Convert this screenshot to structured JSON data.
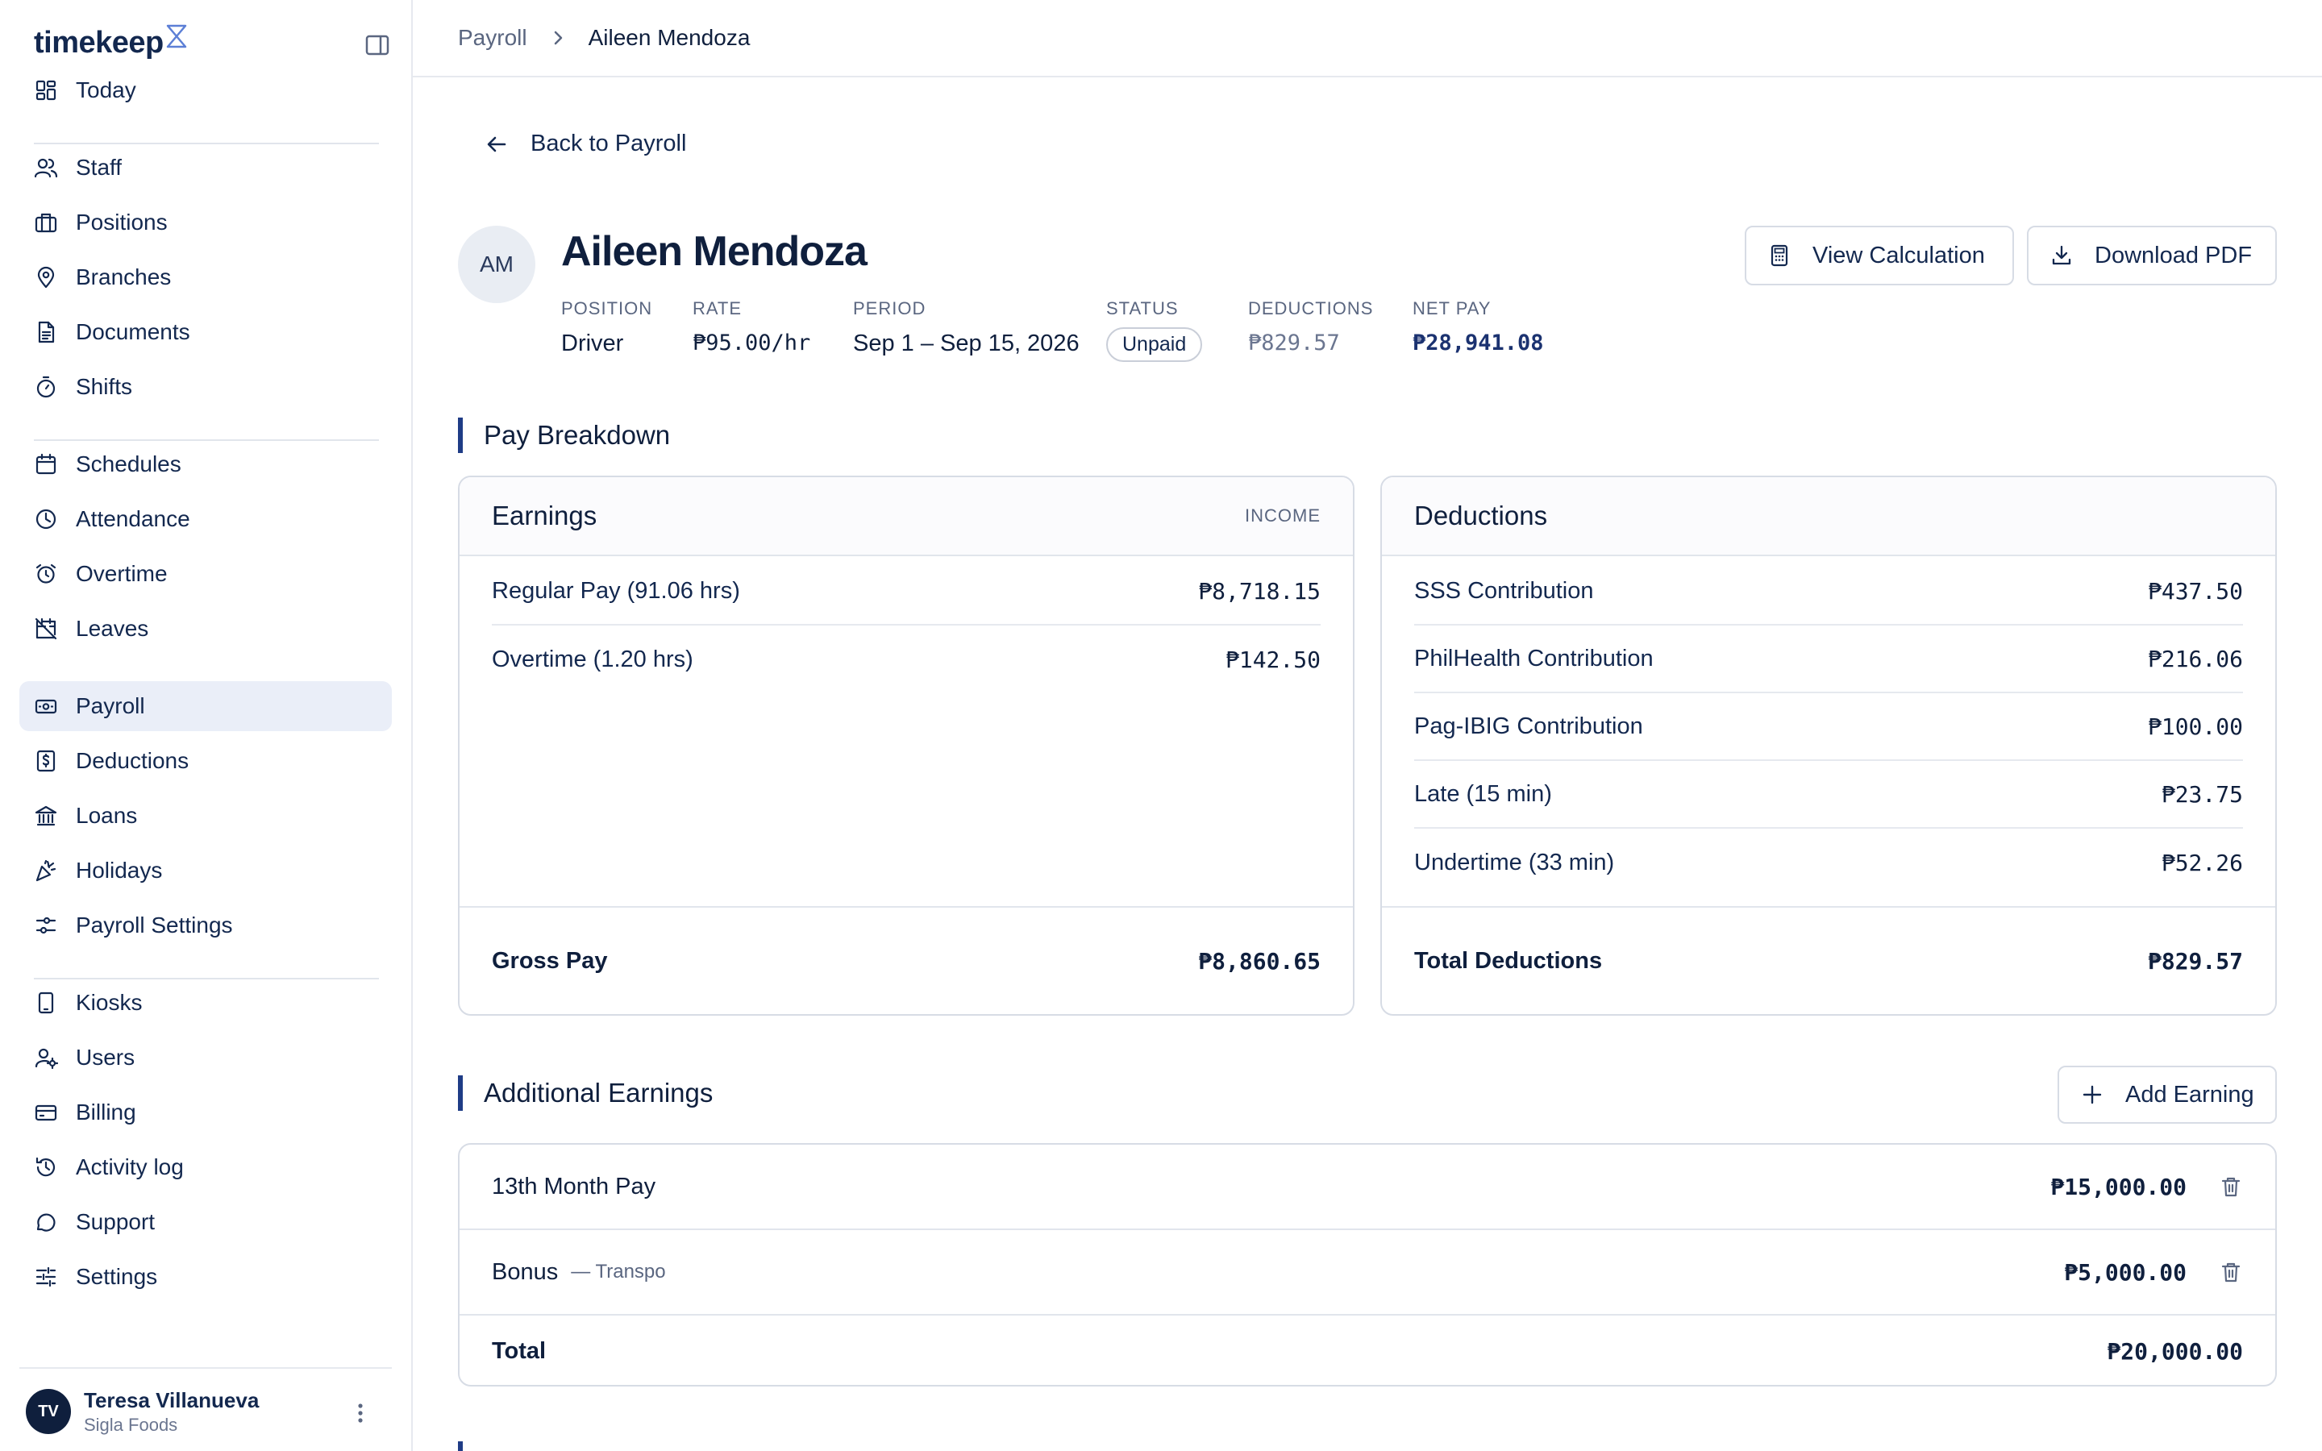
{
  "brand": {
    "name": "timekeep"
  },
  "sidebar": {
    "groups": [
      [
        {
          "label": "Today",
          "icon": "dashboard-icon"
        }
      ],
      [
        {
          "label": "Staff",
          "icon": "users-icon"
        },
        {
          "label": "Positions",
          "icon": "briefcase-icon"
        },
        {
          "label": "Branches",
          "icon": "map-pin-icon"
        },
        {
          "label": "Documents",
          "icon": "document-icon"
        },
        {
          "label": "Shifts",
          "icon": "timer-icon"
        }
      ],
      [
        {
          "label": "Schedules",
          "icon": "calendar-icon"
        },
        {
          "label": "Attendance",
          "icon": "clock-icon"
        },
        {
          "label": "Overtime",
          "icon": "alarm-icon"
        },
        {
          "label": "Leaves",
          "icon": "calendar-off-icon"
        }
      ],
      [
        {
          "label": "Payroll",
          "icon": "banknote-icon",
          "active": true
        },
        {
          "label": "Deductions",
          "icon": "receipt-dollar-icon"
        },
        {
          "label": "Loans",
          "icon": "bank-icon"
        },
        {
          "label": "Holidays",
          "icon": "party-icon"
        },
        {
          "label": "Payroll Settings",
          "icon": "sliders-icon"
        }
      ],
      [
        {
          "label": "Kiosks",
          "icon": "tablet-icon"
        },
        {
          "label": "Users",
          "icon": "user-cog-icon"
        },
        {
          "label": "Billing",
          "icon": "credit-card-icon"
        },
        {
          "label": "Activity log",
          "icon": "history-icon"
        },
        {
          "label": "Support",
          "icon": "chat-icon"
        },
        {
          "label": "Settings",
          "icon": "settings-sliders-icon"
        }
      ]
    ],
    "user": {
      "initials": "TV",
      "name": "Teresa Villanueva",
      "org": "Sigla Foods"
    }
  },
  "breadcrumb": {
    "parent": "Payroll",
    "current": "Aileen Mendoza"
  },
  "back_label": "Back to Payroll",
  "employee": {
    "initials": "AM",
    "name": "Aileen Mendoza",
    "meta": {
      "position_label": "POSITION",
      "position": "Driver",
      "rate_label": "RATE",
      "rate": "₱95.00/hr",
      "period_label": "PERIOD",
      "period": "Sep 1 – Sep 15, 2026",
      "status_label": "STATUS",
      "status": "Unpaid",
      "deductions_label": "DEDUCTIONS",
      "deductions": "₱829.57",
      "netpay_label": "NET PAY",
      "netpay": "₱28,941.08"
    }
  },
  "actions": {
    "view_calculation": "View Calculation",
    "download_pdf": "Download PDF"
  },
  "pay_breakdown": {
    "title": "Pay Breakdown",
    "earnings": {
      "title": "Earnings",
      "tag": "INCOME",
      "rows": [
        {
          "label": "Regular Pay (91.06 hrs)",
          "amount": "₱8,718.15"
        },
        {
          "label": "Overtime (1.20 hrs)",
          "amount": "₱142.50"
        }
      ],
      "total_label": "Gross Pay",
      "total": "₱8,860.65"
    },
    "deductions": {
      "title": "Deductions",
      "rows": [
        {
          "label": "SSS Contribution",
          "amount": "₱437.50"
        },
        {
          "label": "PhilHealth Contribution",
          "amount": "₱216.06"
        },
        {
          "label": "Pag-IBIG Contribution",
          "amount": "₱100.00"
        },
        {
          "label": "Late (15 min)",
          "amount": "₱23.75"
        },
        {
          "label": "Undertime (33 min)",
          "amount": "₱52.26"
        }
      ],
      "total_label": "Total Deductions",
      "total": "₱829.57"
    }
  },
  "additional_earnings": {
    "title": "Additional Earnings",
    "add_label": "Add Earning",
    "rows": [
      {
        "label": "13th Month Pay",
        "note": "",
        "amount": "₱15,000.00"
      },
      {
        "label": "Bonus",
        "note": "— Transpo",
        "amount": "₱5,000.00"
      }
    ],
    "total_label": "Total",
    "total": "₱20,000.00"
  },
  "colors": {
    "accent": "#1f3c86",
    "text": "#0f1f3d",
    "active_bg": "#eaeef8",
    "border": "#d7dce5"
  }
}
